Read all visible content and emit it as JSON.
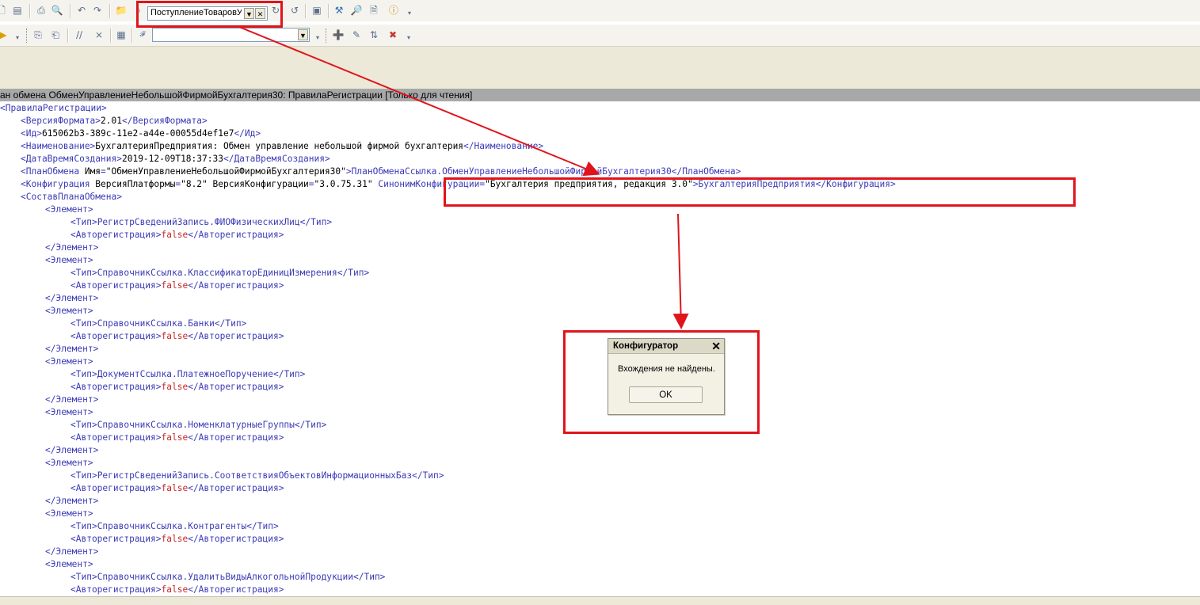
{
  "toolbar": {
    "search_value": "ПоступлениеТоваровУ",
    "icons": [
      "new-doc-icon",
      "open-icon",
      "save-icon",
      "print-icon",
      "preview-icon",
      "undo-icon",
      "redo-icon",
      "find-in-folder-icon",
      "find-icon",
      "find-next-icon",
      "find-prev-icon",
      "window-icon",
      "wizard-icon",
      "search-help-icon",
      "notes-icon",
      "info-icon"
    ]
  },
  "toolbar2": {
    "module_value": "",
    "icons": [
      "play-icon",
      "copy-icon",
      "paste-icon",
      "comment-icon",
      "uncomment-icon",
      "bookmark-icon",
      "procedure-icon",
      "add-item-icon",
      "edit-item-icon",
      "move-item-icon",
      "delete-item-icon"
    ]
  },
  "window": {
    "title": "ан обмена ОбменУправлениеНебольшойФирмойБухгалтерия30: ПравилаРегистрации [Только для чтения]"
  },
  "editor": {
    "lines": [
      {
        "indent": 0,
        "parts": [
          [
            "tag",
            "<"
          ],
          [
            "tag",
            "ПравилаРегистрации"
          ],
          [
            "tag",
            ">"
          ]
        ]
      },
      {
        "indent": 1,
        "parts": [
          [
            "tag",
            "<ВерсияФормата>"
          ],
          [
            "txt",
            "2.01"
          ],
          [
            "tag",
            "</ВерсияФормата>"
          ]
        ]
      },
      {
        "indent": 1,
        "parts": [
          [
            "tag",
            "<Ид>"
          ],
          [
            "txt",
            "615062b3-389c-11e2-a44e-00055d4ef1e7"
          ],
          [
            "tag",
            "</Ид>"
          ]
        ]
      },
      {
        "indent": 1,
        "parts": [
          [
            "tag",
            "<Наименование>"
          ],
          [
            "txt",
            "БухгалтерияПредприятия: Обмен управление небольшой фирмой бухгалтерия"
          ],
          [
            "tag",
            "</Наименование>"
          ]
        ]
      },
      {
        "indent": 1,
        "parts": [
          [
            "tag",
            "<ДатаВремяСоздания>"
          ],
          [
            "txt",
            "2019-12-09T18:37:33"
          ],
          [
            "tag",
            "</ДатаВремяСоздания>"
          ]
        ]
      },
      {
        "indent": 1,
        "parts": [
          [
            "tag",
            "<ПланОбмена "
          ],
          [
            "txt",
            "Имя"
          ],
          [
            "tag",
            "="
          ],
          [
            "txt",
            "\"ОбменУправлениеНебольшойФирмойБухгалтерия30\""
          ],
          [
            "tag",
            ">ПланОбменаСсылка.ОбменУправлениеНебольшойФирмойБухгалтерия30</ПланОбмена>"
          ]
        ]
      },
      {
        "indent": 1,
        "parts": [
          [
            "tag",
            "<Конфигурация "
          ],
          [
            "txt",
            "ВерсияПлатформы"
          ],
          [
            "tag",
            "="
          ],
          [
            "txt",
            "\"8.2\" "
          ],
          [
            "txt",
            "ВерсияКонфигурации"
          ],
          [
            "tag",
            "="
          ],
          [
            "txt",
            "\"3.0.75.31\" "
          ],
          [
            "tag",
            "СинонимКонфигурации"
          ],
          [
            "tag",
            "="
          ],
          [
            "txt",
            "\"Бухгалтерия предприятия, редакция 3.0\""
          ],
          [
            "tag",
            ">БухгалтерияПредприятия</Конфигурация>"
          ]
        ]
      },
      {
        "indent": 1,
        "parts": [
          [
            "tag",
            "<СоставПланаОбмена>"
          ]
        ]
      },
      {
        "indent": 2,
        "parts": [
          [
            "tag",
            "<Элемент>"
          ]
        ]
      },
      {
        "indent": 3,
        "parts": [
          [
            "tag",
            "<Тип>"
          ],
          [
            "tag",
            "РегистрСведенийЗапись.ФИОФизическихЛиц"
          ],
          [
            "tag",
            "</Тип>"
          ]
        ]
      },
      {
        "indent": 3,
        "parts": [
          [
            "tag",
            "<Авторегистрация>"
          ],
          [
            "kw",
            "false"
          ],
          [
            "tag",
            "</Авторегистрация>"
          ]
        ]
      },
      {
        "indent": 2,
        "parts": [
          [
            "tag",
            "</Элемент>"
          ]
        ]
      },
      {
        "indent": 2,
        "parts": [
          [
            "tag",
            "<Элемент>"
          ]
        ]
      },
      {
        "indent": 3,
        "parts": [
          [
            "tag",
            "<Тип>"
          ],
          [
            "tag",
            "СправочникСсылка.КлассификаторЕдиницИзмерения"
          ],
          [
            "tag",
            "</Тип>"
          ]
        ]
      },
      {
        "indent": 3,
        "parts": [
          [
            "tag",
            "<Авторегистрация>"
          ],
          [
            "kw",
            "false"
          ],
          [
            "tag",
            "</Авторегистрация>"
          ]
        ]
      },
      {
        "indent": 2,
        "parts": [
          [
            "tag",
            "</Элемент>"
          ]
        ]
      },
      {
        "indent": 2,
        "parts": [
          [
            "tag",
            "<Элемент>"
          ]
        ]
      },
      {
        "indent": 3,
        "parts": [
          [
            "tag",
            "<Тип>"
          ],
          [
            "tag",
            "СправочникСсылка.Банки"
          ],
          [
            "tag",
            "</Тип>"
          ]
        ]
      },
      {
        "indent": 3,
        "parts": [
          [
            "tag",
            "<Авторегистрация>"
          ],
          [
            "kw",
            "false"
          ],
          [
            "tag",
            "</Авторегистрация>"
          ]
        ]
      },
      {
        "indent": 2,
        "parts": [
          [
            "tag",
            "</Элемент>"
          ]
        ]
      },
      {
        "indent": 2,
        "parts": [
          [
            "tag",
            "<Элемент>"
          ]
        ]
      },
      {
        "indent": 3,
        "parts": [
          [
            "tag",
            "<Тип>"
          ],
          [
            "tag",
            "ДокументСсылка.ПлатежноеПоручение"
          ],
          [
            "tag",
            "</Тип>"
          ]
        ]
      },
      {
        "indent": 3,
        "parts": [
          [
            "tag",
            "<Авторегистрация>"
          ],
          [
            "kw",
            "false"
          ],
          [
            "tag",
            "</Авторегистрация>"
          ]
        ]
      },
      {
        "indent": 2,
        "parts": [
          [
            "tag",
            "</Элемент>"
          ]
        ]
      },
      {
        "indent": 2,
        "parts": [
          [
            "tag",
            "<Элемент>"
          ]
        ]
      },
      {
        "indent": 3,
        "parts": [
          [
            "tag",
            "<Тип>"
          ],
          [
            "tag",
            "СправочникСсылка.НоменклатурныеГруппы"
          ],
          [
            "tag",
            "</Тип>"
          ]
        ]
      },
      {
        "indent": 3,
        "parts": [
          [
            "tag",
            "<Авторегистрация>"
          ],
          [
            "kw",
            "false"
          ],
          [
            "tag",
            "</Авторегистрация>"
          ]
        ]
      },
      {
        "indent": 2,
        "parts": [
          [
            "tag",
            "</Элемент>"
          ]
        ]
      },
      {
        "indent": 2,
        "parts": [
          [
            "tag",
            "<Элемент>"
          ]
        ]
      },
      {
        "indent": 3,
        "parts": [
          [
            "tag",
            "<Тип>"
          ],
          [
            "tag",
            "РегистрСведенийЗапись.СоответствияОбъектовИнформационныхБаз"
          ],
          [
            "tag",
            "</Тип>"
          ]
        ]
      },
      {
        "indent": 3,
        "parts": [
          [
            "tag",
            "<Авторегистрация>"
          ],
          [
            "kw",
            "false"
          ],
          [
            "tag",
            "</Авторегистрация>"
          ]
        ]
      },
      {
        "indent": 2,
        "parts": [
          [
            "tag",
            "</Элемент>"
          ]
        ]
      },
      {
        "indent": 2,
        "parts": [
          [
            "tag",
            "<Элемент>"
          ]
        ]
      },
      {
        "indent": 3,
        "parts": [
          [
            "tag",
            "<Тип>"
          ],
          [
            "tag",
            "СправочникСсылка.Контрагенты"
          ],
          [
            "tag",
            "</Тип>"
          ]
        ]
      },
      {
        "indent": 3,
        "parts": [
          [
            "tag",
            "<Авторегистрация>"
          ],
          [
            "kw",
            "false"
          ],
          [
            "tag",
            "</Авторегистрация>"
          ]
        ]
      },
      {
        "indent": 2,
        "parts": [
          [
            "tag",
            "</Элемент>"
          ]
        ]
      },
      {
        "indent": 2,
        "parts": [
          [
            "tag",
            "<Элемент>"
          ]
        ]
      },
      {
        "indent": 3,
        "parts": [
          [
            "tag",
            "<Тип>"
          ],
          [
            "tag",
            "СправочникСсылка.УдалитьВидыАлкогольнойПродукции"
          ],
          [
            "tag",
            "</Тип>"
          ]
        ]
      },
      {
        "indent": 3,
        "parts": [
          [
            "tag",
            "<Авторегистрация>"
          ],
          [
            "kw",
            "false"
          ],
          [
            "tag",
            "</Авторегистрация>"
          ]
        ]
      }
    ]
  },
  "dialog": {
    "title": "Конфигуратор",
    "message": "Вхождения не найдены.",
    "ok_label": "OK"
  },
  "colors": {
    "highlight": "#e0141b",
    "tag": "#3b3bb6",
    "keyword": "#c62828"
  }
}
